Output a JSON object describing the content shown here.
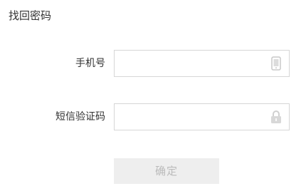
{
  "page": {
    "title": "找回密码"
  },
  "form": {
    "phone": {
      "label": "手机号",
      "value": "",
      "placeholder": "",
      "icon": "phone-icon"
    },
    "sms_code": {
      "label": "短信验证码",
      "value": "",
      "placeholder": "",
      "icon": "lock-icon"
    },
    "submit": {
      "label": "确定",
      "enabled": false
    }
  },
  "colors": {
    "border": "#d6d6d6",
    "icon": "#c8c8c8",
    "button_bg": "#eeeeee",
    "button_text": "#bbbbbb",
    "text": "#333333"
  }
}
